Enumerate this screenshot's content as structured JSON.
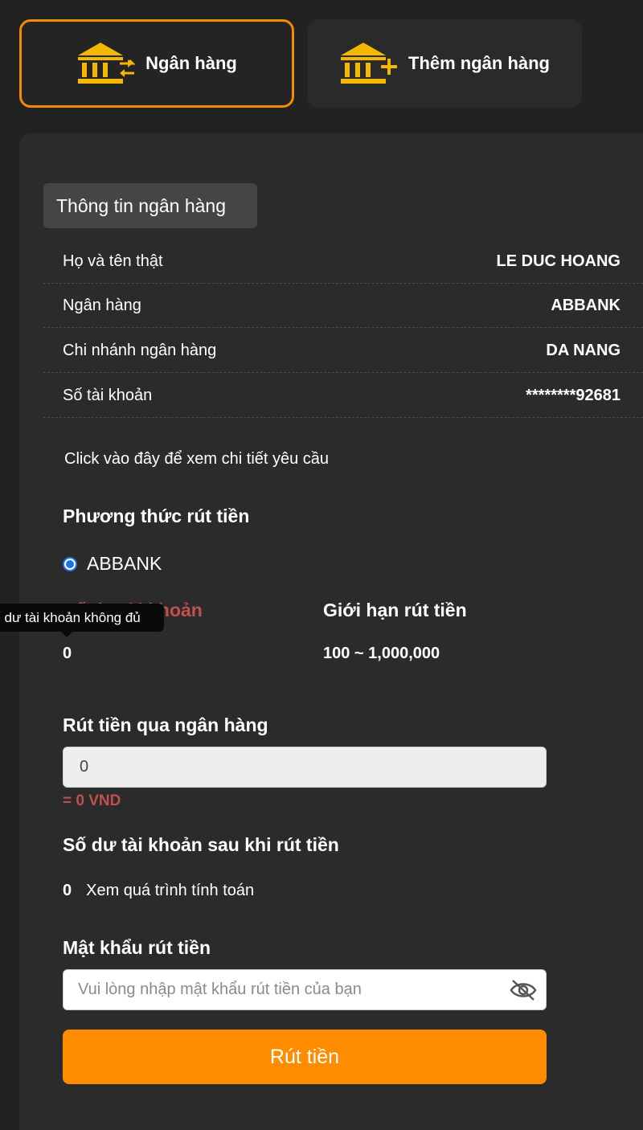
{
  "tabs": [
    {
      "label": "Ngân hàng",
      "icon": "bank-transfer-icon",
      "active": true
    },
    {
      "label": "Thêm ngân hàng",
      "icon": "bank-add-icon",
      "active": false
    }
  ],
  "bank_info": {
    "section_title": "Thông tin ngân hàng",
    "rows": [
      {
        "label": "Họ và tên thật",
        "value": "LE DUC HOANG"
      },
      {
        "label": "Ngân hàng",
        "value": "ABBANK"
      },
      {
        "label": "Chi nhánh ngân hàng",
        "value": "DA NANG"
      },
      {
        "label": "Số tài khoản",
        "value": "********92681"
      }
    ]
  },
  "detail_link": "Click vào đây để xem chi tiết yêu cầu",
  "method": {
    "heading": "Phương thức rút tiền",
    "option": "ABBANK"
  },
  "balance": {
    "label": "Số dư tài khoản",
    "value": "0",
    "tooltip": "Số dư tài khoản không đủ"
  },
  "limit": {
    "label": "Giới hạn rút tiền",
    "value": "100 ~ 1,000,000"
  },
  "withdraw": {
    "heading": "Rút tiền qua ngân hàng",
    "amount_value": "0",
    "converted": "= 0 VND"
  },
  "after_balance": {
    "heading": "Số dư tài khoản sau khi rút tiền",
    "value": "0",
    "calc_link": "Xem quá trình tính toán"
  },
  "password": {
    "heading": "Mật khẩu rút tiền",
    "placeholder": "Vui lòng nhập mật khẩu rút tiền của bạn",
    "toggle_icon": "eye-slash-icon"
  },
  "submit_label": "Rút tiền",
  "colors": {
    "accent": "#ff8c00",
    "icon_gold": "#f5b800",
    "warning_red": "#c0504d",
    "background": "#222222"
  }
}
